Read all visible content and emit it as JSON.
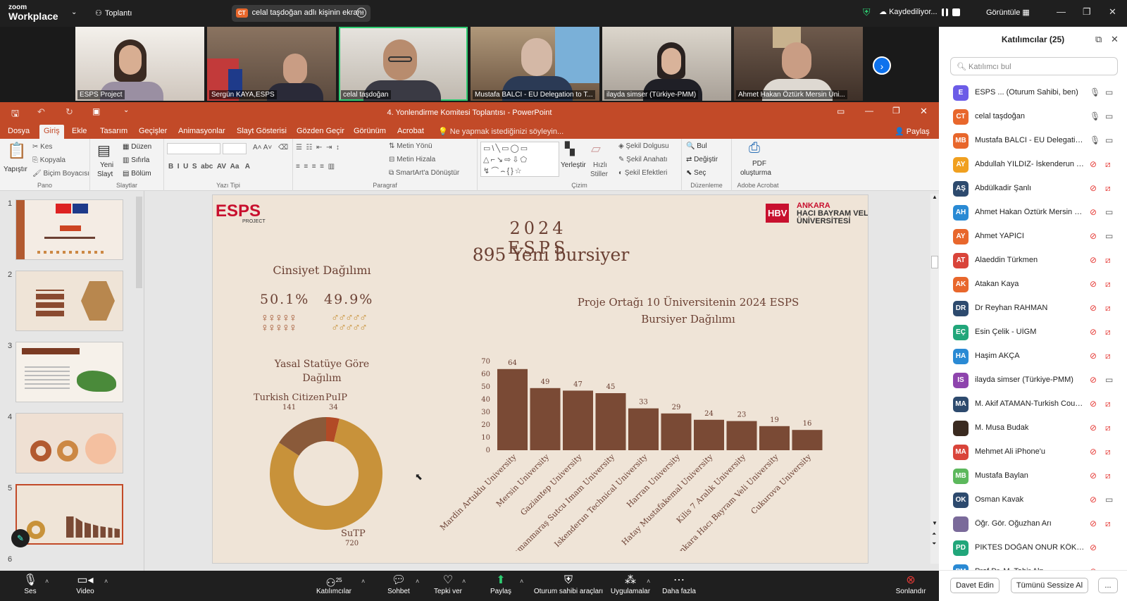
{
  "zoom": {
    "brand_top": "zoom",
    "brand_bottom": "Workplace",
    "meeting_label": "Toplantı",
    "share_avatar": "CT",
    "share_text": "celal taşdoğan adlı kişinin ekranı",
    "recording": "Kaydediliyor...",
    "view": "Görüntüle",
    "accent": "#0e72ed"
  },
  "gallery": [
    {
      "name": "ESPS Project"
    },
    {
      "name": "Sergün KAYA,ESPS"
    },
    {
      "name": "celal taşdoğan"
    },
    {
      "name": "Mustafa BALCI - EU Delegation to T..."
    },
    {
      "name": "ilayda simser (Türkiye-PMM)"
    },
    {
      "name": "Ahmet Hakan Öztürk Mersin Üni..."
    }
  ],
  "ppt": {
    "title": "4. Yonlendirme Komitesi Toplantısı  -  PowerPoint",
    "accent": "#c24a28",
    "tabs": [
      "Dosya",
      "Giriş",
      "Ekle",
      "Tasarım",
      "Geçişler",
      "Animasyonlar",
      "Slayt Gösterisi",
      "Gözden Geçir",
      "Görünüm",
      "Acrobat"
    ],
    "tell_me": "Ne yapmak istediğinizi söyleyin...",
    "share": "Paylaş",
    "ribbon": {
      "paste": "Yapıştır",
      "cut": "Kes",
      "copy": "Kopyala",
      "format_painter": "Biçim Boyacısı",
      "pano": "Pano",
      "new_slide": "Yeni",
      "new_slide2": "Slayt",
      "layout": "Düzen",
      "reset": "Sıfırla",
      "section": "Bölüm",
      "slides": "Slaytlar",
      "font_group": "Yazı Tipi",
      "text_dir": "Metin Yönü",
      "align_text": "Metin Hizala",
      "smartart": "SmartArt'a Dönüştür",
      "paragraph": "Paragraf",
      "arrange": "Yerleştir",
      "quick_styles": "Hızlı",
      "quick_styles2": "Stiller",
      "shape_fill": "Şekil Dolgusu",
      "shape_outline": "Şekil Anahatı",
      "shape_effects": "Şekil Efektleri",
      "drawing": "Çizim",
      "find": "Bul",
      "replace": "Değiştir",
      "select": "Seç",
      "editing": "Düzenleme",
      "pdf": "PDF",
      "pdf2": "oluşturma",
      "acrobat": "Adobe Acrobat"
    },
    "slide_numbers": [
      "1",
      "2",
      "3",
      "4",
      "5",
      "6"
    ]
  },
  "slide": {
    "logo_left": "ESPS",
    "logo_left_sub": "PROJECT",
    "logo_right_mark": "HBV",
    "logo_right_1": "ANKARA",
    "logo_right_2": "HACI BAYRAM VELİ",
    "logo_right_3": "ÜNİVERSİTESİ",
    "title1": "2024 ESPS",
    "title2": "895 Yeni bursiyer",
    "gender_title": "Cinsiyet Dağılımı",
    "gender_left": "50.1%",
    "gender_right": "49.9%",
    "status_title1": "Yasal Statüye Göre",
    "status_title2": "Dağılım",
    "donut_label_tc": "Turkish Citizen",
    "donut_label_pulp": "PuIP",
    "donut_val_tc": "141",
    "donut_val_pulp": "34",
    "donut_label_sutp": "SuTP",
    "donut_val_sutp": "720",
    "bar_title1": "Proje Ortağı 10 Üniversitenin 2024 ESPS",
    "bar_title2": "Bursiyer Dağılımı",
    "colors": {
      "bar": "#7a4a35",
      "donut_main": "#c8923a",
      "donut_dark": "#8a5a3a",
      "donut_red": "#b24a26",
      "female": "#a0522d",
      "male": "#c8923a"
    }
  },
  "chart_data": [
    {
      "type": "bar",
      "title": "Proje Ortağı 10 Üniversitenin 2024 ESPS Bursiyer Dağılımı",
      "categories": [
        "Mardin Artuklu University",
        "Mersin University",
        "Gaziantep University",
        "Kahramanmaraş Sutcu Imam University",
        "Iskenderun Technical University",
        "Harran University",
        "Hatay Mustafakemal University",
        "Kilis 7 Aralık University",
        "Ankara Hacı Bayram Veli University",
        "Cukurova University"
      ],
      "values": [
        64,
        49,
        47,
        45,
        33,
        29,
        24,
        23,
        19,
        16
      ],
      "y_ticks": [
        "0",
        "10",
        "20",
        "30",
        "40",
        "50",
        "60",
        "70"
      ],
      "ylim": [
        0,
        70
      ],
      "grid": false
    },
    {
      "type": "pie",
      "title": "Yasal Statüye Göre Dağılım",
      "categories": [
        "SuTP",
        "Turkish Citizen",
        "PuIP"
      ],
      "values": [
        720,
        141,
        34
      ]
    }
  ],
  "participants": {
    "title": "Katılımcılar (25)",
    "search_placeholder": "Katılımcı bul",
    "invite": "Davet Edin",
    "mute_all": "Tümünü Sessize Al",
    "more": "...",
    "list": [
      {
        "initials": "E",
        "name": "ESPS ... (Oturum Sahibi, ben)",
        "color": "#6c5ce7",
        "mic": "on",
        "cam": "on"
      },
      {
        "initials": "CT",
        "name": "celal taşdoğan",
        "color": "#e8672c",
        "mic": "on",
        "cam": "on"
      },
      {
        "initials": "MB",
        "name": "Mustafa BALCI - EU Delegation...",
        "color": "#e8672c",
        "mic": "on",
        "cam": "on"
      },
      {
        "initials": "AY",
        "name": "Abdullah YILDIZ- İskenderun Te...",
        "color": "#f0a020",
        "mic": "off",
        "cam": "off"
      },
      {
        "initials": "AŞ",
        "name": "Abdülkadir Şanlı",
        "color": "#2d4a6e",
        "mic": "off",
        "cam": "off"
      },
      {
        "initials": "AH",
        "name": "Ahmet Hakan Öztürk Mersin Ü...",
        "color": "#2a8ad4",
        "mic": "off",
        "cam": "on"
      },
      {
        "initials": "AY",
        "name": "Ahmet YAPICI",
        "color": "#e8672c",
        "mic": "off",
        "cam": "on"
      },
      {
        "initials": "AT",
        "name": "Alaeddin Türkmen",
        "color": "#d9443a",
        "mic": "off",
        "cam": "off"
      },
      {
        "initials": "AK",
        "name": "Atakan Kaya",
        "color": "#e8672c",
        "mic": "off",
        "cam": "off"
      },
      {
        "initials": "DR",
        "name": "Dr Reyhan RAHMAN",
        "color": "#2d4a6e",
        "mic": "off",
        "cam": "off"
      },
      {
        "initials": "EÇ",
        "name": "Esin Çelik - UİGM",
        "color": "#21a67a",
        "mic": "off",
        "cam": "off"
      },
      {
        "initials": "HA",
        "name": "Haşim AKÇA",
        "color": "#2a8ad4",
        "mic": "off",
        "cam": "off"
      },
      {
        "initials": "IS",
        "name": "ilayda simser (Türkiye-PMM)",
        "color": "#8e44ad",
        "mic": "off",
        "cam": "on"
      },
      {
        "initials": "MA",
        "name": "M. Akif ATAMAN-Turkish Counc...",
        "color": "#2d4a6e",
        "mic": "off",
        "cam": "off"
      },
      {
        "initials": "",
        "name": "M. Musa Budak",
        "color": "#3a2a20",
        "mic": "off",
        "cam": "off"
      },
      {
        "initials": "MA",
        "name": "Mehmet Ali iPhone'u",
        "color": "#d9443a",
        "mic": "off",
        "cam": "off"
      },
      {
        "initials": "MB",
        "name": "Mustafa Baylan",
        "color": "#5cb85c",
        "mic": "off",
        "cam": "off"
      },
      {
        "initials": "OK",
        "name": "Osman Kavak",
        "color": "#2d4a6e",
        "mic": "off",
        "cam": "on"
      },
      {
        "initials": "",
        "name": "Öğr. Gör. Oğuzhan Arı",
        "color": "#7a6a9a",
        "mic": "off",
        "cam": "off"
      },
      {
        "initials": "PD",
        "name": "PIKTES DOĞAN ONUR KÖKSAL",
        "color": "#21a67a",
        "mic": "off",
        "cam": "none"
      },
      {
        "initials": "PM",
        "name": "Prof.Dr. M. Tahir Alp",
        "color": "#2a8ad4",
        "mic": "off",
        "cam": "off"
      }
    ]
  },
  "bottombar": {
    "audio": "Ses",
    "video": "Video",
    "participants": "Katılımcılar",
    "participants_count": "25",
    "chat": "Sohbet",
    "react": "Tepki ver",
    "share": "Paylaş",
    "host_tools": "Oturum sahibi araçları",
    "apps": "Uygulamalar",
    "more": "Daha fazla",
    "end": "Sonlandır"
  }
}
